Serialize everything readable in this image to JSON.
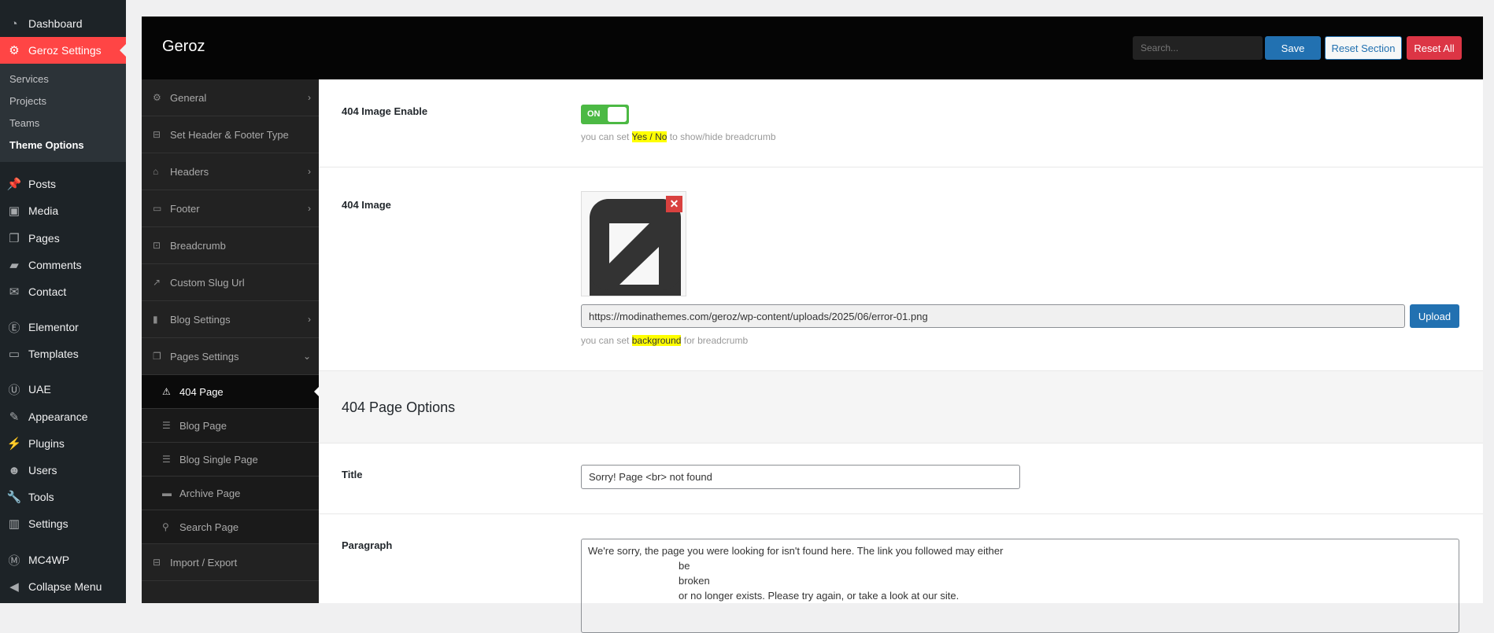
{
  "wp_menu": {
    "items": [
      {
        "label": "Dashboard",
        "icon": "dashboard-icon"
      },
      {
        "label": "Geroz Settings",
        "icon": "gear-icon",
        "active": true
      },
      {
        "label": "Posts",
        "icon": "pin-icon"
      },
      {
        "label": "Media",
        "icon": "media-icon"
      },
      {
        "label": "Pages",
        "icon": "pages-icon"
      },
      {
        "label": "Comments",
        "icon": "comment-icon"
      },
      {
        "label": "Contact",
        "icon": "mail-icon"
      },
      {
        "label": "Elementor",
        "icon": "elementor-icon"
      },
      {
        "label": "Templates",
        "icon": "folder-icon"
      },
      {
        "label": "UAE",
        "icon": "uae-icon"
      },
      {
        "label": "Appearance",
        "icon": "brush-icon"
      },
      {
        "label": "Plugins",
        "icon": "plugin-icon"
      },
      {
        "label": "Users",
        "icon": "user-icon"
      },
      {
        "label": "Tools",
        "icon": "wrench-icon"
      },
      {
        "label": "Settings",
        "icon": "sliders-icon"
      },
      {
        "label": "MC4WP",
        "icon": "mc4wp-icon"
      },
      {
        "label": "Collapse Menu",
        "icon": "collapse-icon"
      }
    ],
    "submenu": [
      "Services",
      "Projects",
      "Teams",
      "Theme Options"
    ]
  },
  "header": {
    "title": "Geroz",
    "search_placeholder": "Search...",
    "save": "Save",
    "reset_section": "Reset Section",
    "reset_all": "Reset All"
  },
  "nav": {
    "items": [
      "General",
      "Set Header & Footer Type",
      "Headers",
      "Footer",
      "Breadcrumb",
      "Custom Slug Url",
      "Blog Settings",
      "Pages Settings"
    ],
    "subitems": [
      "404 Page",
      "Blog Page",
      "Blog Single Page",
      "Archive Page",
      "Search Page"
    ],
    "last": "Import / Export"
  },
  "fields": {
    "enable": {
      "label": "404 Image Enable",
      "toggle": "ON",
      "help_pre": "you can set ",
      "help_hl": "Yes / No",
      "help_post": " to show/hide breadcrumb"
    },
    "image": {
      "label": "404 Image",
      "url": "https://modinathemes.com/geroz/wp-content/uploads/2025/06/error-01.png",
      "upload": "Upload",
      "help_pre": "you can set ",
      "help_hl": "background",
      "help_post": " for breadcrumb"
    },
    "section_title": "404 Page Options",
    "title": {
      "label": "Title",
      "value": "Sorry! Page <br> not found"
    },
    "paragraph": {
      "label": "Paragraph",
      "lines": [
        "We're sorry, the page you were looking for isn't found here. The link you followed may either",
        "be",
        "broken",
        "or no longer exists. Please try again, or take a look at our site."
      ]
    }
  },
  "colors": {
    "accent": "#2271b1",
    "danger": "#dc3545",
    "active_menu": "#ff4545",
    "toggle_on": "#4cb944"
  }
}
